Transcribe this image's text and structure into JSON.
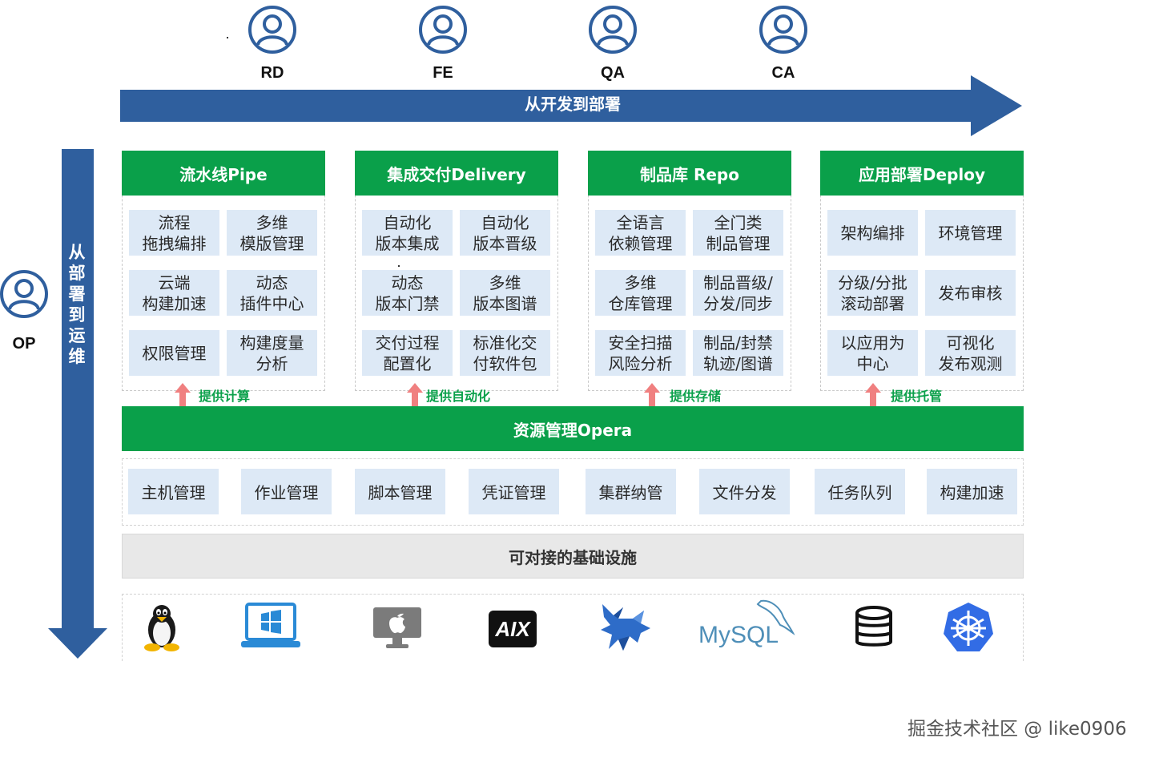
{
  "roles": {
    "rd": "RD",
    "fe": "FE",
    "qa": "QA",
    "ca": "CA",
    "op": "OP"
  },
  "horizontal_arrow": "从开发到部署",
  "vertical_arrow": "从部署到运维",
  "modules": [
    {
      "title": "流水线Pipe",
      "cells": [
        "流程\n拖拽编排",
        "多维\n模版管理",
        "云端\n构建加速",
        "动态\n插件中心",
        "权限管理",
        "构建度量\n分析"
      ],
      "provide": "提供计算"
    },
    {
      "title": "集成交付Delivery",
      "cells": [
        "自动化\n版本集成",
        "自动化\n版本晋级",
        "动态\n版本门禁",
        "多维\n版本图谱",
        "交付过程\n配置化",
        "标准化交\n付软件包"
      ],
      "provide": "提供自动化"
    },
    {
      "title": "制品库 Repo",
      "cells": [
        "全语言\n依赖管理",
        "全门类\n制品管理",
        "多维\n仓库管理",
        "制品晋级/\n分发/同步",
        "安全扫描\n风险分析",
        "制品/封禁\n轨迹/图谱"
      ],
      "provide": "提供存储"
    },
    {
      "title": "应用部署Deploy",
      "cells": [
        "架构编排",
        "环境管理",
        "分级/分批\n滚动部署",
        "发布审核",
        "以应用为\n中心",
        "可视化\n发布观测"
      ],
      "provide": "提供托管"
    }
  ],
  "opera": {
    "title": "资源管理Opera",
    "items": [
      "主机管理",
      "作业管理",
      "脚本管理",
      "凭证管理",
      "集群纳管",
      "文件分发",
      "任务队列",
      "构建加速"
    ]
  },
  "infrastructure": {
    "title": "可对接的基础设施",
    "icons": [
      "linux-tux-icon",
      "windows-laptop-icon",
      "macos-apple-icon",
      "aix-icon",
      "kylin-icon",
      "mysql-icon",
      "database-icon",
      "kubernetes-icon"
    ],
    "mysql_text": "MySQL"
  },
  "watermark": "掘金技术社区 @ like0906",
  "colors": {
    "green": "#0aa04a",
    "blue": "#2f5f9e",
    "cell_bg": "#dde9f6",
    "arrow_up": "#f08080"
  }
}
